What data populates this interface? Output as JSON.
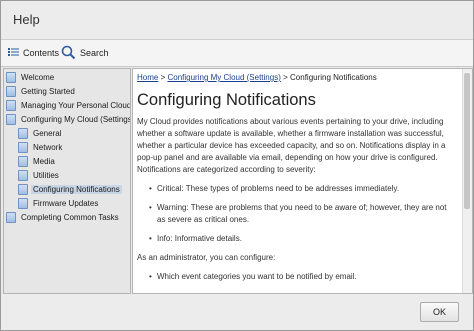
{
  "window": {
    "title": "Help"
  },
  "toolbar": {
    "contents_label": "Contents",
    "search_label": "Search"
  },
  "sidebar": {
    "items": [
      {
        "label": "Welcome"
      },
      {
        "label": "Getting Started"
      },
      {
        "label": "Managing Your Personal Cloud"
      },
      {
        "label": "Configuring My Cloud (Settings)"
      },
      {
        "label": "General"
      },
      {
        "label": "Network"
      },
      {
        "label": "Media"
      },
      {
        "label": "Utilities"
      },
      {
        "label": "Configuring Notifications",
        "selected": true
      },
      {
        "label": "Firmware Updates"
      },
      {
        "label": "Completing Common Tasks"
      }
    ]
  },
  "content": {
    "breadcrumb": {
      "home": "Home",
      "sep": ">",
      "parent": "Configuring My Cloud (Settings)",
      "current": "Configuring Notifications"
    },
    "title": "Configuring Notifications",
    "intro": "My Cloud provides notifications about various events pertaining to your drive, including whether a software update is available, whether a firmware installation was successful, whether a particular device has exceeded capacity, and so on. Notifications display in a pop-up panel and are available via email, depending on how your drive is configured. Notifications are categorized according to severity:",
    "severity": [
      "Critical: These types of problems need to be addresses immediately.",
      "Warning: These are problems that you need to be aware of; however, they are not as severe as critical ones.",
      "Info: Informative details."
    ],
    "admin_intro": "As an administrator, you can configure:",
    "admin_items": [
      "Which event categories you want to be notified by email."
    ]
  },
  "footer": {
    "ok_label": "OK"
  }
}
